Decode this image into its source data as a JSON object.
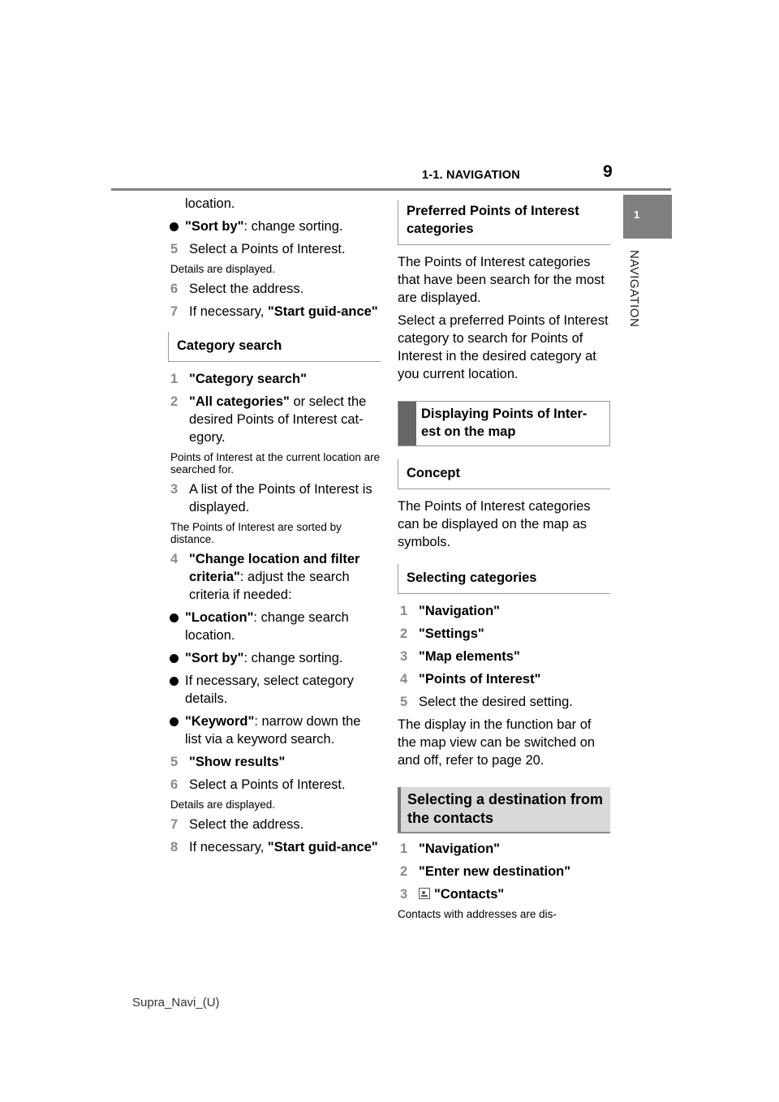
{
  "header": {
    "section_title": "1-1. NAVIGATION",
    "page_number": "9"
  },
  "side_tab": {
    "chapter_number": "1",
    "chapter_label": "NAVIGATION"
  },
  "left_column": {
    "continuation": "location.",
    "bullet_sort": {
      "bold": "\"Sort by\"",
      "rest": ": change sorting."
    },
    "step5": {
      "num": "5",
      "text": "Select a Points of Interest."
    },
    "note_details": "Details are displayed.",
    "step6": {
      "num": "6",
      "text": "Select the address."
    },
    "step7": {
      "num": "7",
      "text": "If necessary, ",
      "bold": "\"Start guid-ance\""
    },
    "category_heading": "Category search",
    "cat_step1": {
      "num": "1",
      "bold": "\"Category search\""
    },
    "cat_step2": {
      "num": "2",
      "bold": "\"All categories\"",
      "rest": " or select the desired Points of Interest cat-egory."
    },
    "note_searched": "Points of Interest at the current location are searched for.",
    "cat_step3": {
      "num": "3",
      "text": "A list of the Points of Interest is displayed."
    },
    "note_sorted": "The Points of Interest are sorted by distance.",
    "cat_step4": {
      "num": "4",
      "bold": "\"Change location and filter criteria\"",
      "rest": ": adjust the search criteria if needed:"
    },
    "bullet_location": {
      "bold": "\"Location\"",
      "rest": ": change search location."
    },
    "bullet_sort2": {
      "bold": "\"Sort by\"",
      "rest": ": change sorting."
    },
    "bullet_category": "If necessary, select category details.",
    "bullet_keyword": {
      "bold": "\"Keyword\"",
      "rest": ": narrow down the list via a keyword search."
    },
    "cat_step5": {
      "num": "5",
      "bold": "\"Show results\""
    },
    "cat_step6": {
      "num": "6",
      "text": "Select a Points of Interest."
    },
    "note_details2": "Details are displayed.",
    "cat_step7": {
      "num": "7",
      "text": "Select the address."
    },
    "cat_step8": {
      "num": "8",
      "text": "If necessary, ",
      "bold": "\"Start guid-ance\""
    }
  },
  "right_column": {
    "preferred_heading": "Preferred Points of Interest categories",
    "preferred_p1": "The Points of Interest categories that have been search for the most are displayed.",
    "preferred_p2": "Select a preferred Points of Interest category to search for Points of Interest in the desired category at you current location.",
    "displaying_heading": "Displaying Points of Inter-est on the map",
    "concept_heading": "Concept",
    "concept_p": "The Points of Interest categories can be displayed on the map as symbols.",
    "selecting_heading": "Selecting categories",
    "sel_steps": [
      {
        "num": "1",
        "bold": "\"Navigation\""
      },
      {
        "num": "2",
        "bold": "\"Settings\""
      },
      {
        "num": "3",
        "bold": "\"Map elements\""
      },
      {
        "num": "4",
        "bold": "\"Points of Interest\""
      },
      {
        "num": "5",
        "text": "Select the desired setting."
      }
    ],
    "selecting_p": "The display in the function bar of the map view can be switched on and off, refer to page 20.",
    "contacts_heading": "Selecting a destination from the contacts",
    "contact_steps": [
      {
        "num": "1",
        "bold": "\"Navigation\""
      },
      {
        "num": "2",
        "bold": "\"Enter new destination\""
      },
      {
        "num": "3",
        "icon": "contacts-icon",
        "bold": "\"Contacts\""
      }
    ],
    "contacts_note": "Contacts with addresses are dis-"
  },
  "footer": {
    "doc_id": "Supra_Navi_(U)"
  }
}
